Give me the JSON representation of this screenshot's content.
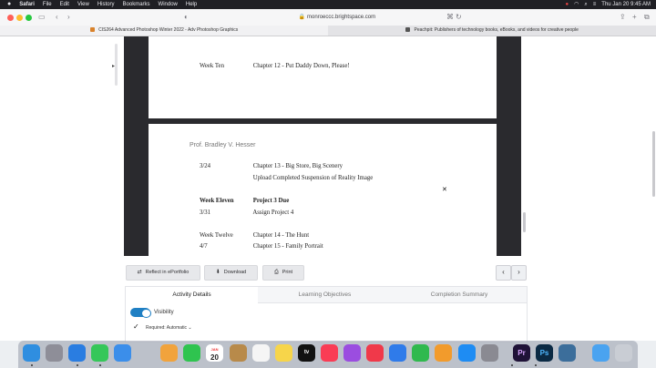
{
  "menubar": {
    "apple": "",
    "items": [
      "Safari",
      "File",
      "Edit",
      "View",
      "History",
      "Bookmarks",
      "Window",
      "Help"
    ],
    "clock": "Thu Jan 20  9:45 AM"
  },
  "browser": {
    "url": "monroeccc.brightspace.com",
    "tabs": [
      {
        "label": "CIS264 Advanced Photoshop Winter 2022 - Adv Photoshop Graphics"
      },
      {
        "label": "Peachpit: Publishers of technology books, eBooks, and videos for creative people"
      }
    ]
  },
  "document": {
    "sheet1": {
      "week": "Week Ten",
      "chapter": "Chapter 12 - Put Daddy Down, Please!"
    },
    "sheet2": {
      "author": "Prof. Bradley V. Hesser",
      "rows": [
        {
          "c1": "3/24",
          "c2": "Chapter 13 - Big Store, Big Scenery",
          "bold": false
        },
        {
          "c1": "",
          "c2": "Upload Completed Suspension of Reality Image",
          "bold": false
        },
        {
          "c1": "Week Eleven",
          "c2": "Project 3 Due",
          "bold": true
        },
        {
          "c1": "3/31",
          "c2": "Assign Project 4",
          "bold": false
        },
        {
          "c1": "Week Twelve",
          "c2": "Chapter 14 - The Hunt",
          "bold": false
        },
        {
          "c1": "4/7",
          "c2": "Chapter 15 - Family Portrait",
          "bold": false
        }
      ]
    }
  },
  "actions": {
    "reflect": "Reflect in ePortfolio",
    "download": "Download",
    "print": "Print",
    "prev": "‹",
    "next": "›"
  },
  "panel": {
    "tabs": [
      "Activity Details",
      "Learning Objectives",
      "Completion Summary"
    ],
    "visibility": "Visibility",
    "required": "Required: Automatic"
  },
  "dock": {
    "calendar_day": "20",
    "calendar_month": "JAN",
    "apps": [
      {
        "icon": "finder-icon",
        "color": "#2f8ee0"
      },
      {
        "icon": "launchpad-icon",
        "color": "#8e8e98"
      },
      {
        "icon": "safari-icon",
        "color": "#2a7de1"
      },
      {
        "icon": "messages-icon",
        "color": "#35c759"
      },
      {
        "icon": "mail-icon",
        "color": "#3b8eea"
      },
      {
        "icon": "photos-icon",
        "color": "#f1a33c"
      },
      {
        "icon": "facetime-icon",
        "color": "#2fc44f"
      },
      {
        "icon": "calendar-icon",
        "color": "#ffffff"
      },
      {
        "icon": "wallet-icon",
        "color": "#b88a4a"
      },
      {
        "icon": "reminders-icon",
        "color": "#f5f5f5"
      },
      {
        "icon": "notes-icon",
        "color": "#f7d54a"
      },
      {
        "icon": "appletv-icon",
        "color": "#111111"
      },
      {
        "icon": "music-icon",
        "color": "#fa3c55"
      },
      {
        "icon": "podcasts-icon",
        "color": "#9b4de0"
      },
      {
        "icon": "news-icon",
        "color": "#f0394a"
      },
      {
        "icon": "keynote-icon",
        "color": "#2f7bea"
      },
      {
        "icon": "numbers-icon",
        "color": "#30b94e"
      },
      {
        "icon": "pages-icon",
        "color": "#f29b2c"
      },
      {
        "icon": "appstore-icon",
        "color": "#1e8cf3"
      },
      {
        "icon": "system-preferences-icon",
        "color": "#8a8a92"
      },
      {
        "icon": "premiere-icon",
        "color": "#1f1237"
      },
      {
        "icon": "photoshop-icon",
        "color": "#0b2a44"
      },
      {
        "icon": "network-icon",
        "color": "#3c6e9b"
      },
      {
        "icon": "folder-icon",
        "color": "#4aa3f0"
      },
      {
        "icon": "trash-icon",
        "color": "#c9cdd4"
      }
    ],
    "premiere_label": "Pr",
    "photoshop_label": "Ps",
    "appletv_label": "tv"
  }
}
